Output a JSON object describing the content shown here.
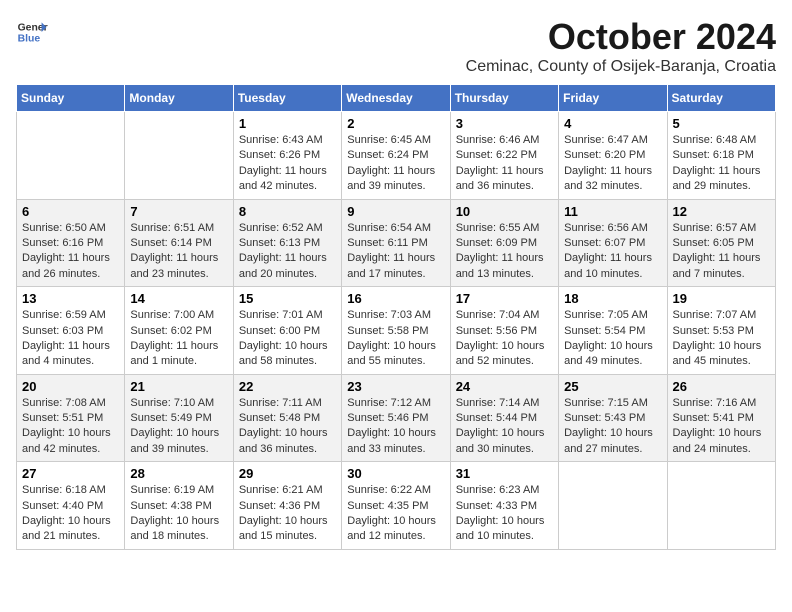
{
  "logo": {
    "text_general": "General",
    "text_blue": "Blue"
  },
  "title": {
    "month": "October 2024",
    "location": "Ceminac, County of Osijek-Baranja, Croatia"
  },
  "weekdays": [
    "Sunday",
    "Monday",
    "Tuesday",
    "Wednesday",
    "Thursday",
    "Friday",
    "Saturday"
  ],
  "weeks": [
    [
      {
        "day": "",
        "sunrise": "",
        "sunset": "",
        "daylight": ""
      },
      {
        "day": "",
        "sunrise": "",
        "sunset": "",
        "daylight": ""
      },
      {
        "day": "1",
        "sunrise": "Sunrise: 6:43 AM",
        "sunset": "Sunset: 6:26 PM",
        "daylight": "Daylight: 11 hours and 42 minutes."
      },
      {
        "day": "2",
        "sunrise": "Sunrise: 6:45 AM",
        "sunset": "Sunset: 6:24 PM",
        "daylight": "Daylight: 11 hours and 39 minutes."
      },
      {
        "day": "3",
        "sunrise": "Sunrise: 6:46 AM",
        "sunset": "Sunset: 6:22 PM",
        "daylight": "Daylight: 11 hours and 36 minutes."
      },
      {
        "day": "4",
        "sunrise": "Sunrise: 6:47 AM",
        "sunset": "Sunset: 6:20 PM",
        "daylight": "Daylight: 11 hours and 32 minutes."
      },
      {
        "day": "5",
        "sunrise": "Sunrise: 6:48 AM",
        "sunset": "Sunset: 6:18 PM",
        "daylight": "Daylight: 11 hours and 29 minutes."
      }
    ],
    [
      {
        "day": "6",
        "sunrise": "Sunrise: 6:50 AM",
        "sunset": "Sunset: 6:16 PM",
        "daylight": "Daylight: 11 hours and 26 minutes."
      },
      {
        "day": "7",
        "sunrise": "Sunrise: 6:51 AM",
        "sunset": "Sunset: 6:14 PM",
        "daylight": "Daylight: 11 hours and 23 minutes."
      },
      {
        "day": "8",
        "sunrise": "Sunrise: 6:52 AM",
        "sunset": "Sunset: 6:13 PM",
        "daylight": "Daylight: 11 hours and 20 minutes."
      },
      {
        "day": "9",
        "sunrise": "Sunrise: 6:54 AM",
        "sunset": "Sunset: 6:11 PM",
        "daylight": "Daylight: 11 hours and 17 minutes."
      },
      {
        "day": "10",
        "sunrise": "Sunrise: 6:55 AM",
        "sunset": "Sunset: 6:09 PM",
        "daylight": "Daylight: 11 hours and 13 minutes."
      },
      {
        "day": "11",
        "sunrise": "Sunrise: 6:56 AM",
        "sunset": "Sunset: 6:07 PM",
        "daylight": "Daylight: 11 hours and 10 minutes."
      },
      {
        "day": "12",
        "sunrise": "Sunrise: 6:57 AM",
        "sunset": "Sunset: 6:05 PM",
        "daylight": "Daylight: 11 hours and 7 minutes."
      }
    ],
    [
      {
        "day": "13",
        "sunrise": "Sunrise: 6:59 AM",
        "sunset": "Sunset: 6:03 PM",
        "daylight": "Daylight: 11 hours and 4 minutes."
      },
      {
        "day": "14",
        "sunrise": "Sunrise: 7:00 AM",
        "sunset": "Sunset: 6:02 PM",
        "daylight": "Daylight: 11 hours and 1 minute."
      },
      {
        "day": "15",
        "sunrise": "Sunrise: 7:01 AM",
        "sunset": "Sunset: 6:00 PM",
        "daylight": "Daylight: 10 hours and 58 minutes."
      },
      {
        "day": "16",
        "sunrise": "Sunrise: 7:03 AM",
        "sunset": "Sunset: 5:58 PM",
        "daylight": "Daylight: 10 hours and 55 minutes."
      },
      {
        "day": "17",
        "sunrise": "Sunrise: 7:04 AM",
        "sunset": "Sunset: 5:56 PM",
        "daylight": "Daylight: 10 hours and 52 minutes."
      },
      {
        "day": "18",
        "sunrise": "Sunrise: 7:05 AM",
        "sunset": "Sunset: 5:54 PM",
        "daylight": "Daylight: 10 hours and 49 minutes."
      },
      {
        "day": "19",
        "sunrise": "Sunrise: 7:07 AM",
        "sunset": "Sunset: 5:53 PM",
        "daylight": "Daylight: 10 hours and 45 minutes."
      }
    ],
    [
      {
        "day": "20",
        "sunrise": "Sunrise: 7:08 AM",
        "sunset": "Sunset: 5:51 PM",
        "daylight": "Daylight: 10 hours and 42 minutes."
      },
      {
        "day": "21",
        "sunrise": "Sunrise: 7:10 AM",
        "sunset": "Sunset: 5:49 PM",
        "daylight": "Daylight: 10 hours and 39 minutes."
      },
      {
        "day": "22",
        "sunrise": "Sunrise: 7:11 AM",
        "sunset": "Sunset: 5:48 PM",
        "daylight": "Daylight: 10 hours and 36 minutes."
      },
      {
        "day": "23",
        "sunrise": "Sunrise: 7:12 AM",
        "sunset": "Sunset: 5:46 PM",
        "daylight": "Daylight: 10 hours and 33 minutes."
      },
      {
        "day": "24",
        "sunrise": "Sunrise: 7:14 AM",
        "sunset": "Sunset: 5:44 PM",
        "daylight": "Daylight: 10 hours and 30 minutes."
      },
      {
        "day": "25",
        "sunrise": "Sunrise: 7:15 AM",
        "sunset": "Sunset: 5:43 PM",
        "daylight": "Daylight: 10 hours and 27 minutes."
      },
      {
        "day": "26",
        "sunrise": "Sunrise: 7:16 AM",
        "sunset": "Sunset: 5:41 PM",
        "daylight": "Daylight: 10 hours and 24 minutes."
      }
    ],
    [
      {
        "day": "27",
        "sunrise": "Sunrise: 6:18 AM",
        "sunset": "Sunset: 4:40 PM",
        "daylight": "Daylight: 10 hours and 21 minutes."
      },
      {
        "day": "28",
        "sunrise": "Sunrise: 6:19 AM",
        "sunset": "Sunset: 4:38 PM",
        "daylight": "Daylight: 10 hours and 18 minutes."
      },
      {
        "day": "29",
        "sunrise": "Sunrise: 6:21 AM",
        "sunset": "Sunset: 4:36 PM",
        "daylight": "Daylight: 10 hours and 15 minutes."
      },
      {
        "day": "30",
        "sunrise": "Sunrise: 6:22 AM",
        "sunset": "Sunset: 4:35 PM",
        "daylight": "Daylight: 10 hours and 12 minutes."
      },
      {
        "day": "31",
        "sunrise": "Sunrise: 6:23 AM",
        "sunset": "Sunset: 4:33 PM",
        "daylight": "Daylight: 10 hours and 10 minutes."
      },
      {
        "day": "",
        "sunrise": "",
        "sunset": "",
        "daylight": ""
      },
      {
        "day": "",
        "sunrise": "",
        "sunset": "",
        "daylight": ""
      }
    ]
  ]
}
